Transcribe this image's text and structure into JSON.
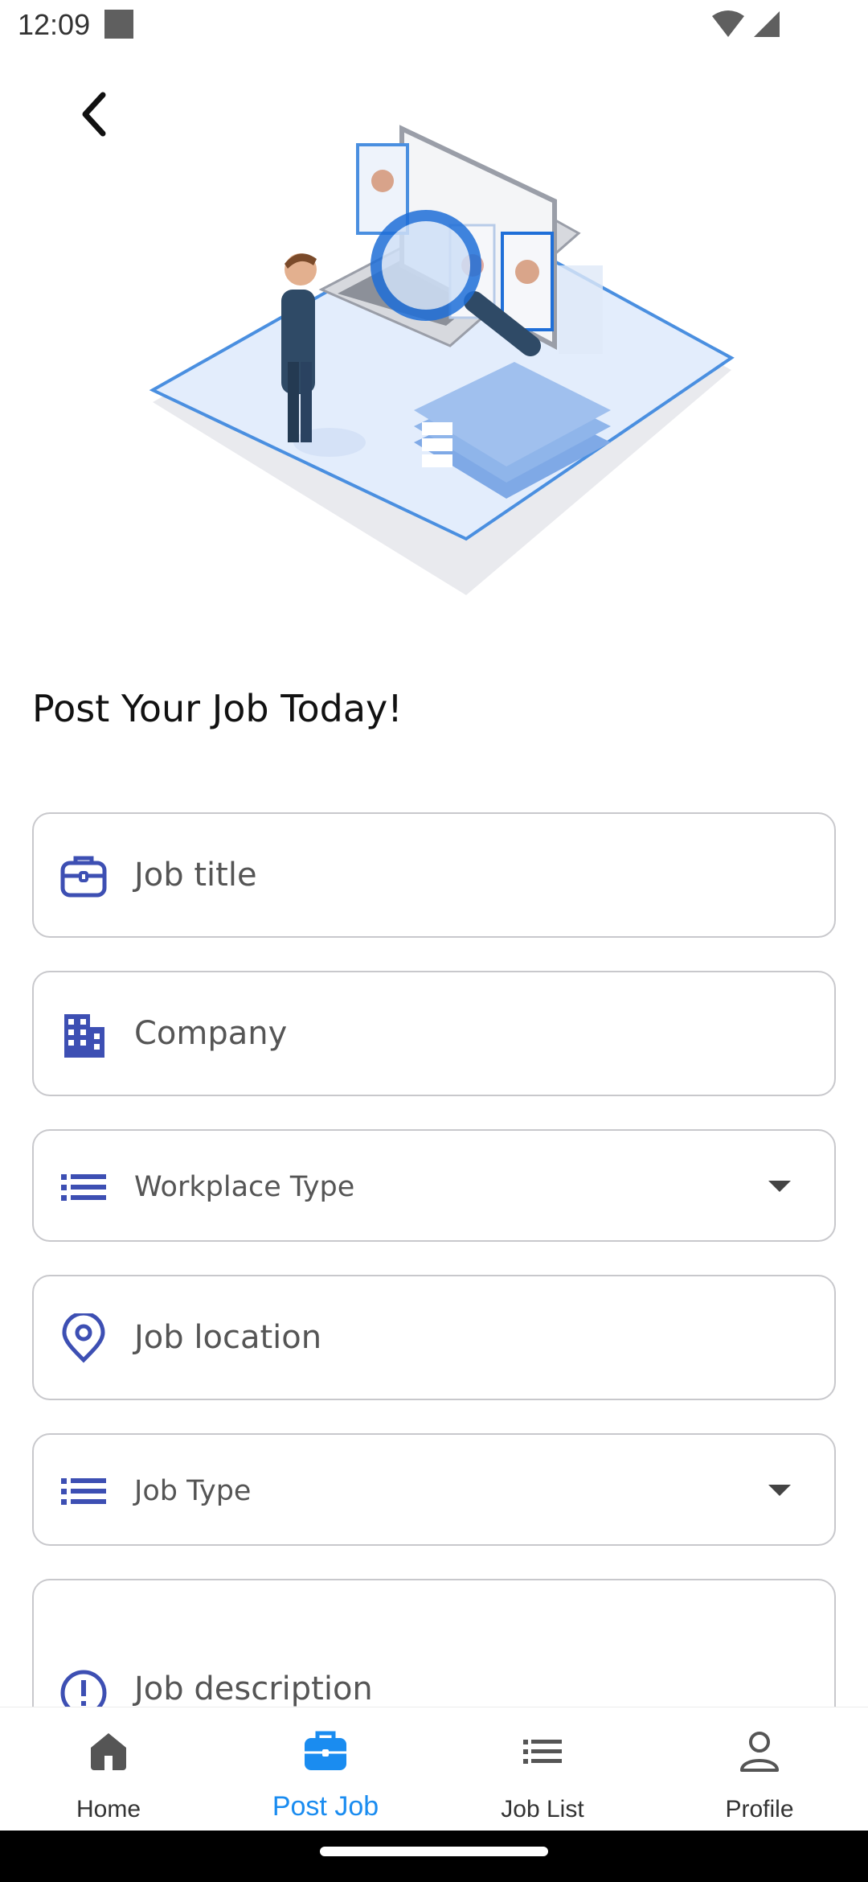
{
  "status": {
    "time": "12:09"
  },
  "page": {
    "title": "Post Your Job Today!"
  },
  "form": {
    "job_title": {
      "placeholder": "Job title"
    },
    "company": {
      "placeholder": "Company"
    },
    "workplace_type": {
      "placeholder": "Workplace Type"
    },
    "job_location": {
      "placeholder": "Job location"
    },
    "job_type": {
      "placeholder": "Job Type"
    },
    "job_description": {
      "placeholder": "Job description"
    }
  },
  "nav": {
    "items": [
      {
        "label": "Home",
        "icon": "home-icon"
      },
      {
        "label": "Post Job",
        "icon": "briefcase-icon",
        "active": true
      },
      {
        "label": "Job List",
        "icon": "list-icon"
      },
      {
        "label": "Profile",
        "icon": "person-icon"
      }
    ]
  },
  "colors": {
    "accent": "#1a8cf0",
    "icon_indigo": "#3d4fb3",
    "hero_blue": "#4a8fe0",
    "border": "#c8c8cc"
  }
}
